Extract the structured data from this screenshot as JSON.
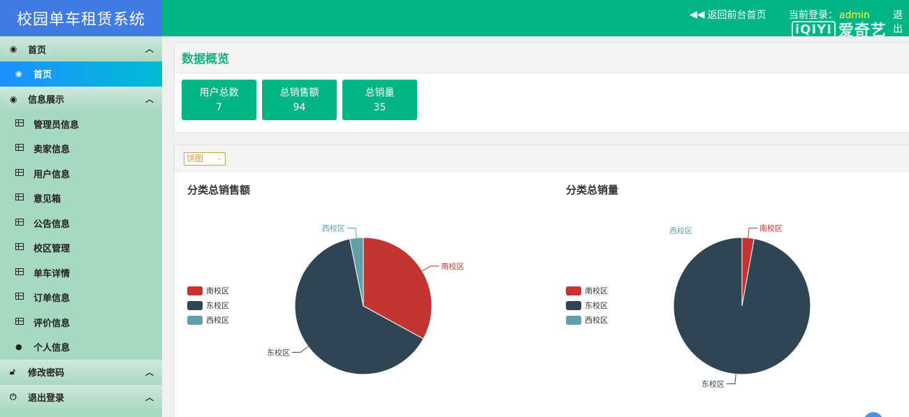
{
  "app": {
    "title": "校园单车租赁系统",
    "back_label": "返回前台首页",
    "login_prefix": "当前登录：",
    "login_user": "admin",
    "logout_label": "退出",
    "watermark": "爱奇艺",
    "watermark_logo": "iQIYI"
  },
  "sidebar": {
    "groups": [
      {
        "label": "首页",
        "items": [
          {
            "label": "首页",
            "active": true
          }
        ]
      },
      {
        "label": "信息展示",
        "items": [
          {
            "label": "管理员信息"
          },
          {
            "label": "卖家信息"
          },
          {
            "label": "用户信息"
          },
          {
            "label": "意见箱"
          },
          {
            "label": "公告信息"
          },
          {
            "label": "校区管理"
          },
          {
            "label": "单车详情"
          },
          {
            "label": "订单信息"
          },
          {
            "label": "评价信息"
          },
          {
            "label": "个人信息"
          }
        ]
      },
      {
        "label": "修改密码",
        "items": []
      },
      {
        "label": "退出登录",
        "items": []
      }
    ]
  },
  "overview": {
    "title": "数据概览",
    "stats": [
      {
        "label": "用户总数",
        "value": "7"
      },
      {
        "label": "总销售额",
        "value": "94"
      },
      {
        "label": "总销量",
        "value": "35"
      }
    ]
  },
  "charts_panel": {
    "chart_type_select": "饼图"
  },
  "colors": {
    "south": "#c23531",
    "east": "#2f4554",
    "west": "#61a0a8",
    "brand": "#03b584"
  },
  "chart_data": [
    {
      "type": "pie",
      "title": "分类总销售额",
      "categories": [
        "南校区",
        "东校区",
        "西校区"
      ],
      "values": [
        31,
        60,
        3
      ],
      "legend_position": "left"
    },
    {
      "type": "pie",
      "title": "分类总销量",
      "categories": [
        "南校区",
        "东校区",
        "西校区"
      ],
      "values": [
        1,
        34,
        0
      ],
      "legend_position": "left"
    }
  ]
}
